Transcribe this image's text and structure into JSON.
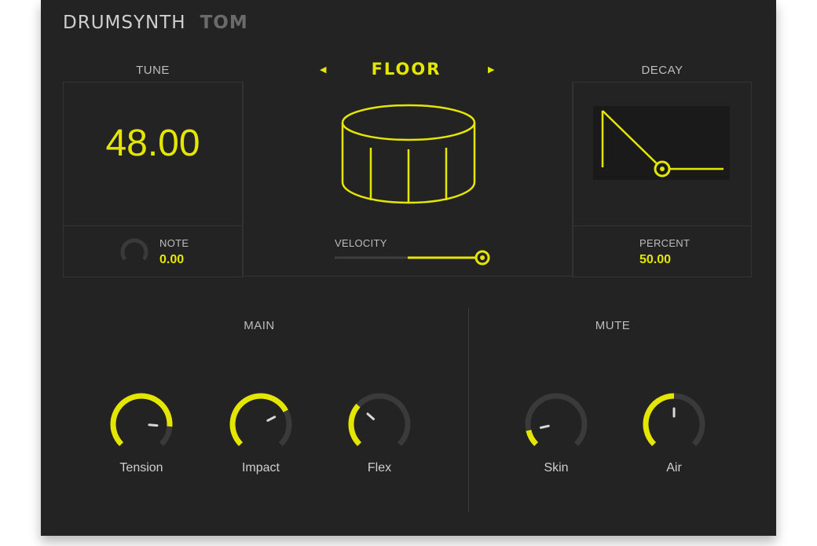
{
  "header": {
    "product": "DRUMSYNTH",
    "instrument": "TOM"
  },
  "tune": {
    "label": "TUNE",
    "value": "48.00",
    "note_label": "NOTE",
    "note_value": "0.00"
  },
  "type_selector": {
    "prev_icon": "caret-left-icon",
    "label": "FLOOR",
    "next_icon": "caret-right-icon"
  },
  "velocity": {
    "label": "VELOCITY",
    "level": 0.98
  },
  "decay": {
    "label": "DECAY",
    "percent_label": "PERCENT",
    "percent_value": "50.00"
  },
  "main": {
    "title": "MAIN",
    "knobs": [
      {
        "label": "Tension",
        "level": 0.85
      },
      {
        "label": "Impact",
        "level": 0.73
      },
      {
        "label": "Flex",
        "level": 0.32
      }
    ]
  },
  "mute": {
    "title": "MUTE",
    "knobs": [
      {
        "label": "Skin",
        "level": 0.12
      },
      {
        "label": "Air",
        "level": 0.5
      }
    ]
  },
  "colors": {
    "accent": "#e5e600",
    "panel": "#232323",
    "inactive_ring": "#3a3a3a"
  }
}
